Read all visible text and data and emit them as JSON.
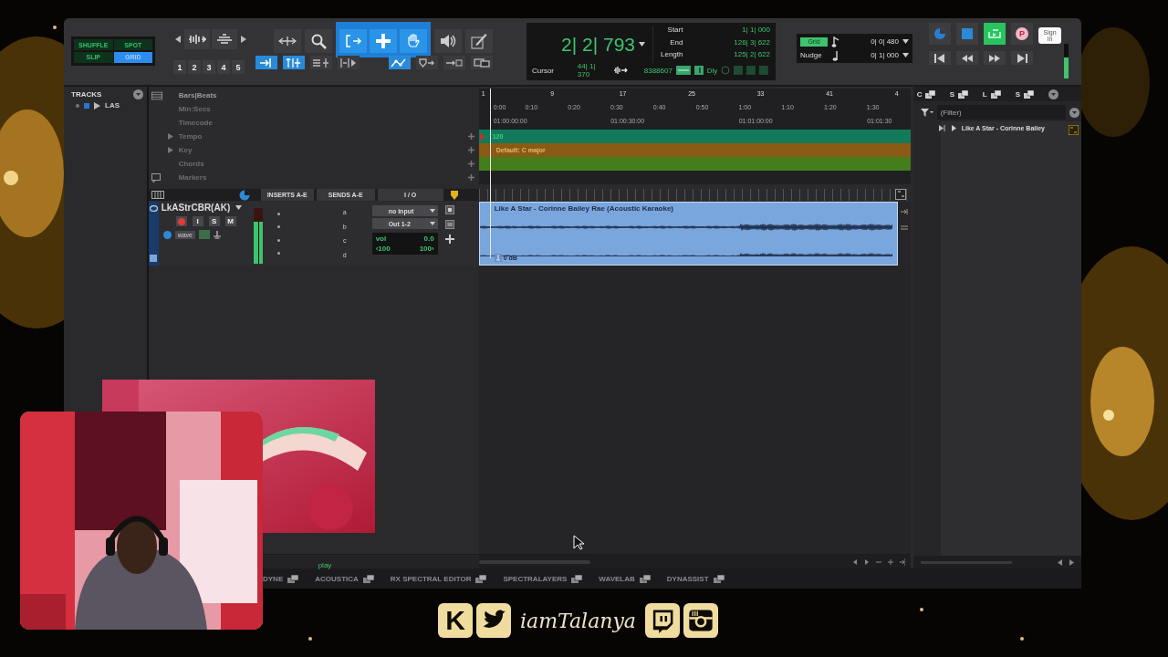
{
  "edit_modes": [
    {
      "label": "SHUFFLE",
      "selected": false
    },
    {
      "label": "SPOT",
      "selected": false
    },
    {
      "label": "SLIP",
      "selected": false
    },
    {
      "label": "GRID",
      "selected": true
    }
  ],
  "zoom_presets": [
    "1",
    "2",
    "3",
    "4",
    "5"
  ],
  "tools": [
    {
      "kind": "spacer",
      "selected": false
    },
    {
      "kind": "zoom",
      "selected": false
    },
    {
      "kind": "trim",
      "selected": true
    },
    {
      "kind": "selector",
      "selected": true
    },
    {
      "kind": "grabber",
      "selected": true
    },
    {
      "kind": "scrub",
      "selected": false
    },
    {
      "kind": "pencil",
      "selected": false
    }
  ],
  "toggles": [
    {
      "kind": "insert",
      "on": true
    },
    {
      "kind": "link",
      "on": true
    },
    {
      "kind": "list",
      "on": false
    },
    {
      "kind": "bracket",
      "on": false
    },
    {
      "kind": "automation",
      "on": true
    },
    {
      "kind": "shield",
      "on": false
    },
    {
      "kind": "arrow",
      "on": false
    },
    {
      "kind": "windows",
      "on": false
    }
  ],
  "counter": {
    "main": "2| 2| 793",
    "rows": [
      {
        "label": "Start",
        "value": "1| 1| 000"
      },
      {
        "label": "End",
        "value": "126| 3| 622"
      },
      {
        "label": "Length",
        "value": "125| 2| 622"
      }
    ],
    "cursor_label": "Cursor",
    "cursor_value": "44| 1| 370",
    "sample_value": "8388607",
    "delay_label": "Dly"
  },
  "grid": {
    "label": "Grid",
    "value": "0| 0| 480"
  },
  "nudge": {
    "label": "Nudge",
    "value": "0| 1| 000"
  },
  "transport": [
    {
      "kind": "online",
      "on": false
    },
    {
      "kind": "stop",
      "on": false
    },
    {
      "kind": "loop",
      "on": true
    },
    {
      "kind": "record",
      "on": false,
      "label": "P"
    },
    {
      "kind": "start"
    },
    {
      "kind": "rewind"
    },
    {
      "kind": "forward"
    },
    {
      "kind": "end"
    }
  ],
  "sign_in": "Sign in",
  "master_meter": {
    "level": 0.6
  },
  "tracks_panel": {
    "title": "TRACKS",
    "items": [
      {
        "name": "LAS"
      }
    ]
  },
  "rulers": [
    {
      "label": "Bars|Beats",
      "expandable": false,
      "addable": false
    },
    {
      "label": "Min:Secs",
      "expandable": false,
      "addable": false
    },
    {
      "label": "Timecode",
      "expandable": false,
      "addable": false
    },
    {
      "label": "Tempo",
      "expandable": true,
      "addable": true
    },
    {
      "label": "Key",
      "expandable": true,
      "addable": true
    },
    {
      "label": "Chords",
      "expandable": false,
      "addable": true
    },
    {
      "label": "Markers",
      "expandable": false,
      "addable": true
    }
  ],
  "timeline": {
    "bars": [
      "1",
      "9",
      "17",
      "25",
      "33",
      "41",
      "4"
    ],
    "min_secs": [
      "0:00",
      "0:10",
      "0:20",
      "0:30",
      "0:40",
      "0:50",
      "1:00",
      "1:10",
      "1:20",
      "1:30"
    ],
    "timecode": [
      "01:00:00:00",
      "01:00:30:00",
      "01:01:00:00",
      "01:01:30"
    ],
    "tempo": "120",
    "key": "Default: C major",
    "clip": {
      "title": "Like A Star - Corinne Bailey Rae (Acoustic Karaoke)",
      "gain": "0 dB"
    }
  },
  "track_columns": [
    "INSERTS A-E",
    "SENDS A-E",
    "I / O"
  ],
  "track": {
    "name": "LkAStrCBR(AK)",
    "buttons": [
      "I",
      "S",
      "M"
    ],
    "mode": "wave",
    "meter": {
      "level": 0.75
    },
    "sends": [
      "a",
      "b",
      "c",
      "d"
    ],
    "input": "no input",
    "output": "Out 1-2",
    "volume_label": "vol",
    "volume": "0.0",
    "pan_left": "‹100",
    "pan_right": "100›"
  },
  "status": "play",
  "clips_panel": {
    "tabs": [
      "C",
      "S",
      "L",
      "S"
    ],
    "filter_placeholder": "(Filter)",
    "items": [
      {
        "name": "Like A Star - Corinne Bailey"
      }
    ]
  },
  "plugin_tabs": [
    "DYNE",
    "ACOUSTICA",
    "RX SPECTRAL EDITOR",
    "SPECTRALAYERS",
    "WAVELAB",
    "DYNASSIST"
  ],
  "overlay": {
    "items": [
      {
        "kind": "kick",
        "label": "K"
      },
      {
        "kind": "twitter"
      },
      {
        "kind": "handle",
        "label": "iamTalanya"
      },
      {
        "kind": "twitch"
      },
      {
        "kind": "instagram"
      }
    ]
  }
}
